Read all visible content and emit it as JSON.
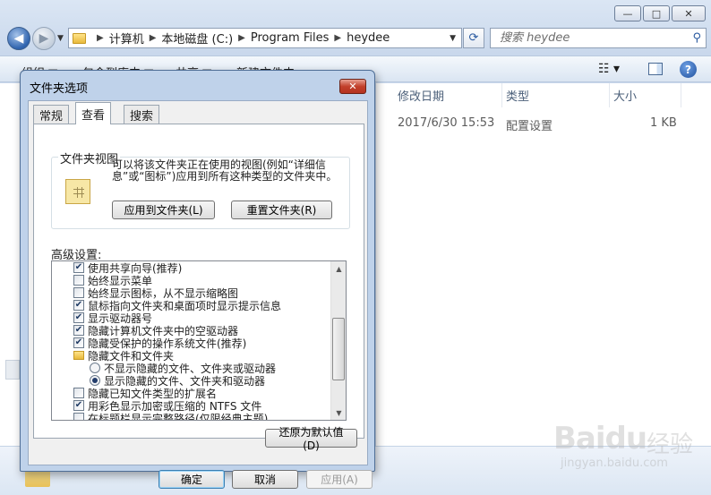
{
  "explorer": {
    "breadcrumbs": [
      "计算机",
      "本地磁盘 (C:)",
      "Program Files",
      "heydee"
    ],
    "search_placeholder": "搜索 heydee",
    "toolbar": [
      "组织 ▼",
      "包含到库中 ▼",
      "共享 ▼",
      "新建文件夹"
    ],
    "columns": {
      "date": "修改日期",
      "type": "类型",
      "size": "大小"
    },
    "file_row": {
      "date": "2017/6/30 15:53",
      "type": "配置设置",
      "size": "1 KB"
    }
  },
  "dialog": {
    "title": "文件夹选项",
    "tabs": [
      "常规",
      "查看",
      "搜索"
    ],
    "active_tab": "查看",
    "folder_views": {
      "legend": "文件夹视图",
      "description": "可以将该文件夹正在使用的视图(例如“详细信息”或“图标”)应用到所有这种类型的文件夹中。",
      "apply_button": "应用到文件夹(L)",
      "reset_button": "重置文件夹(R)"
    },
    "advanced_label": "高级设置:",
    "advanced_items": [
      {
        "kind": "checkbox",
        "checked": true,
        "indent": 1,
        "label": "使用共享向导(推荐)"
      },
      {
        "kind": "checkbox",
        "checked": false,
        "indent": 1,
        "label": "始终显示菜单"
      },
      {
        "kind": "checkbox",
        "checked": false,
        "indent": 1,
        "label": "始终显示图标，从不显示缩略图"
      },
      {
        "kind": "checkbox",
        "checked": true,
        "indent": 1,
        "label": "鼠标指向文件夹和桌面项时显示提示信息"
      },
      {
        "kind": "checkbox",
        "checked": true,
        "indent": 1,
        "label": "显示驱动器号"
      },
      {
        "kind": "checkbox",
        "checked": true,
        "indent": 1,
        "label": "隐藏计算机文件夹中的空驱动器"
      },
      {
        "kind": "checkbox",
        "checked": true,
        "indent": 1,
        "label": "隐藏受保护的操作系统文件(推荐)"
      },
      {
        "kind": "folder",
        "checked": false,
        "indent": 1,
        "label": "隐藏文件和文件夹"
      },
      {
        "kind": "radio",
        "checked": false,
        "indent": 2,
        "label": "不显示隐藏的文件、文件夹或驱动器"
      },
      {
        "kind": "radio",
        "checked": true,
        "indent": 2,
        "label": "显示隐藏的文件、文件夹和驱动器"
      },
      {
        "kind": "checkbox",
        "checked": false,
        "indent": 1,
        "label": "隐藏已知文件类型的扩展名"
      },
      {
        "kind": "checkbox",
        "checked": true,
        "indent": 1,
        "label": "用彩色显示加密或压缩的 NTFS 文件"
      },
      {
        "kind": "checkbox",
        "checked": false,
        "indent": 1,
        "label": "在标题栏显示完整路径(仅限经典主题)"
      }
    ],
    "restore_defaults": "还原为默认值(D)",
    "ok": "确定",
    "cancel": "取消",
    "apply": "应用(A)"
  },
  "watermark": {
    "brand": "Baidu",
    "chinese": "经验",
    "url": "jingyan.baidu.com"
  },
  "icons": [
    "back-arrow-icon",
    "forward-arrow-icon",
    "folder-icon",
    "refresh-icon",
    "search-icon",
    "help-icon",
    "close-icon",
    "view-options-icon",
    "preview-pane-icon",
    "folder-views-icon"
  ]
}
